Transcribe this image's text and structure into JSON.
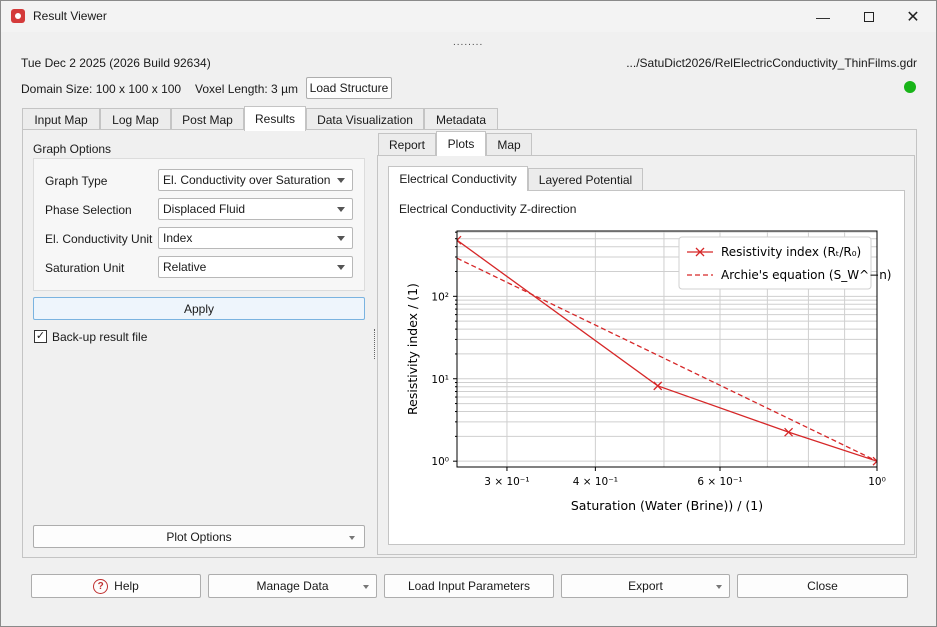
{
  "window": {
    "title": "Result Viewer",
    "min_icon": "minimize-icon",
    "max_icon": "maximize-icon",
    "close_icon": "close-icon"
  },
  "info": {
    "build": "Tue Dec 2 2025 (2026 Build 92634)",
    "file_path": ".../SatuDict2026/RelElectricConductivity_ThinFilms.gdr",
    "domain_size": "Domain Size: 100 x 100 x 100",
    "voxel_length": "Voxel Length: 3 µm",
    "load_structure": "Load Structure",
    "status_color": "#18b418"
  },
  "main_tabs": [
    "Input Map",
    "Log Map",
    "Post Map",
    "Results",
    "Data Visualization",
    "Metadata"
  ],
  "graph_options": {
    "title": "Graph Options",
    "rows": [
      {
        "label": "Graph Type",
        "value": "El. Conductivity over Saturation"
      },
      {
        "label": "Phase Selection",
        "value": "Displaced Fluid"
      },
      {
        "label": "El. Conductivity Unit",
        "value": "Index"
      },
      {
        "label": "Saturation Unit",
        "value": "Relative"
      }
    ],
    "apply": "Apply",
    "backup_label": "Back-up result file",
    "backup_checked": true,
    "plot_options": "Plot Options"
  },
  "right_tabs": [
    "Report",
    "Plots",
    "Map"
  ],
  "plot_tabs": [
    "Electrical Conductivity",
    "Layered Potential"
  ],
  "plot_title": "Electrical Conductivity Z-direction",
  "chart_data": {
    "type": "line",
    "x_scale": "log",
    "y_scale": "log",
    "xlabel": "Saturation (Water (Brine)) / (1)",
    "ylabel": "Resistivity index / (1)",
    "xlim": [
      0.255,
      1.0
    ],
    "ylim": [
      0.85,
      620
    ],
    "x_ticks": [
      {
        "value": 0.3,
        "label": "3 × 10⁻¹"
      },
      {
        "value": 0.4,
        "label": "4 × 10⁻¹"
      },
      {
        "value": 0.6,
        "label": "6 × 10⁻¹"
      },
      {
        "value": 1.0,
        "label": "10⁰"
      }
    ],
    "y_ticks": [
      {
        "value": 1,
        "label": "10⁰"
      },
      {
        "value": 10,
        "label": "10¹"
      },
      {
        "value": 100,
        "label": "10²"
      }
    ],
    "grid": true,
    "legend_position": "top-right",
    "series": [
      {
        "name": "Resistivity index (Rₜ/R₀)",
        "color": "#d62728",
        "style": "solid",
        "marker": "x",
        "x": [
          0.255,
          0.49,
          0.75,
          1.0
        ],
        "y": [
          480,
          8.2,
          2.25,
          1.0
        ]
      },
      {
        "name": "Archie's equation (S_W^−n)",
        "color": "#d62728",
        "style": "dashed",
        "marker": "none",
        "x": [
          0.255,
          1.0
        ],
        "y": [
          290,
          1.0
        ]
      }
    ]
  },
  "footer": {
    "help": "Help",
    "manage_data": "Manage Data",
    "load_input": "Load Input Parameters",
    "export": "Export",
    "close": "Close"
  }
}
